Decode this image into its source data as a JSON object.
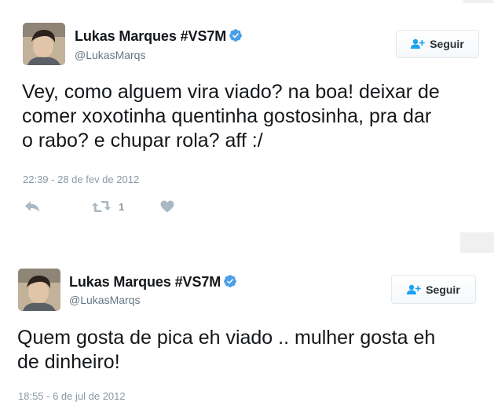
{
  "tweets": [
    {
      "author_name": "Lukas Marques #VS7M",
      "handle": "@LukasMarqs",
      "follow_label": "Seguir",
      "text": "Vey, como alguem vira viado? na boa! deixar de\ncomer xoxotinha quentinha gostosinha, pra dar\no rabo? e chupar rola? aff :/",
      "timestamp": "22:39 - 28 de fev de 2012",
      "retweet_count": "1"
    },
    {
      "author_name": "Lukas Marques #VS7M",
      "handle": "@LukasMarqs",
      "follow_label": "Seguir",
      "text": "Quem gosta de pica eh viado .. mulher gosta eh\nde dinheiro!",
      "timestamp": "18:55 - 6 de jul de 2012"
    }
  ],
  "colors": {
    "verified": "#4aa0e6",
    "follow_icon": "#1da1f2",
    "action_icon": "#aab8c2",
    "secondary_text": "#657786"
  },
  "icons": [
    "verified-badge-icon",
    "add-user-icon",
    "reply-icon",
    "retweet-icon",
    "like-icon"
  ]
}
